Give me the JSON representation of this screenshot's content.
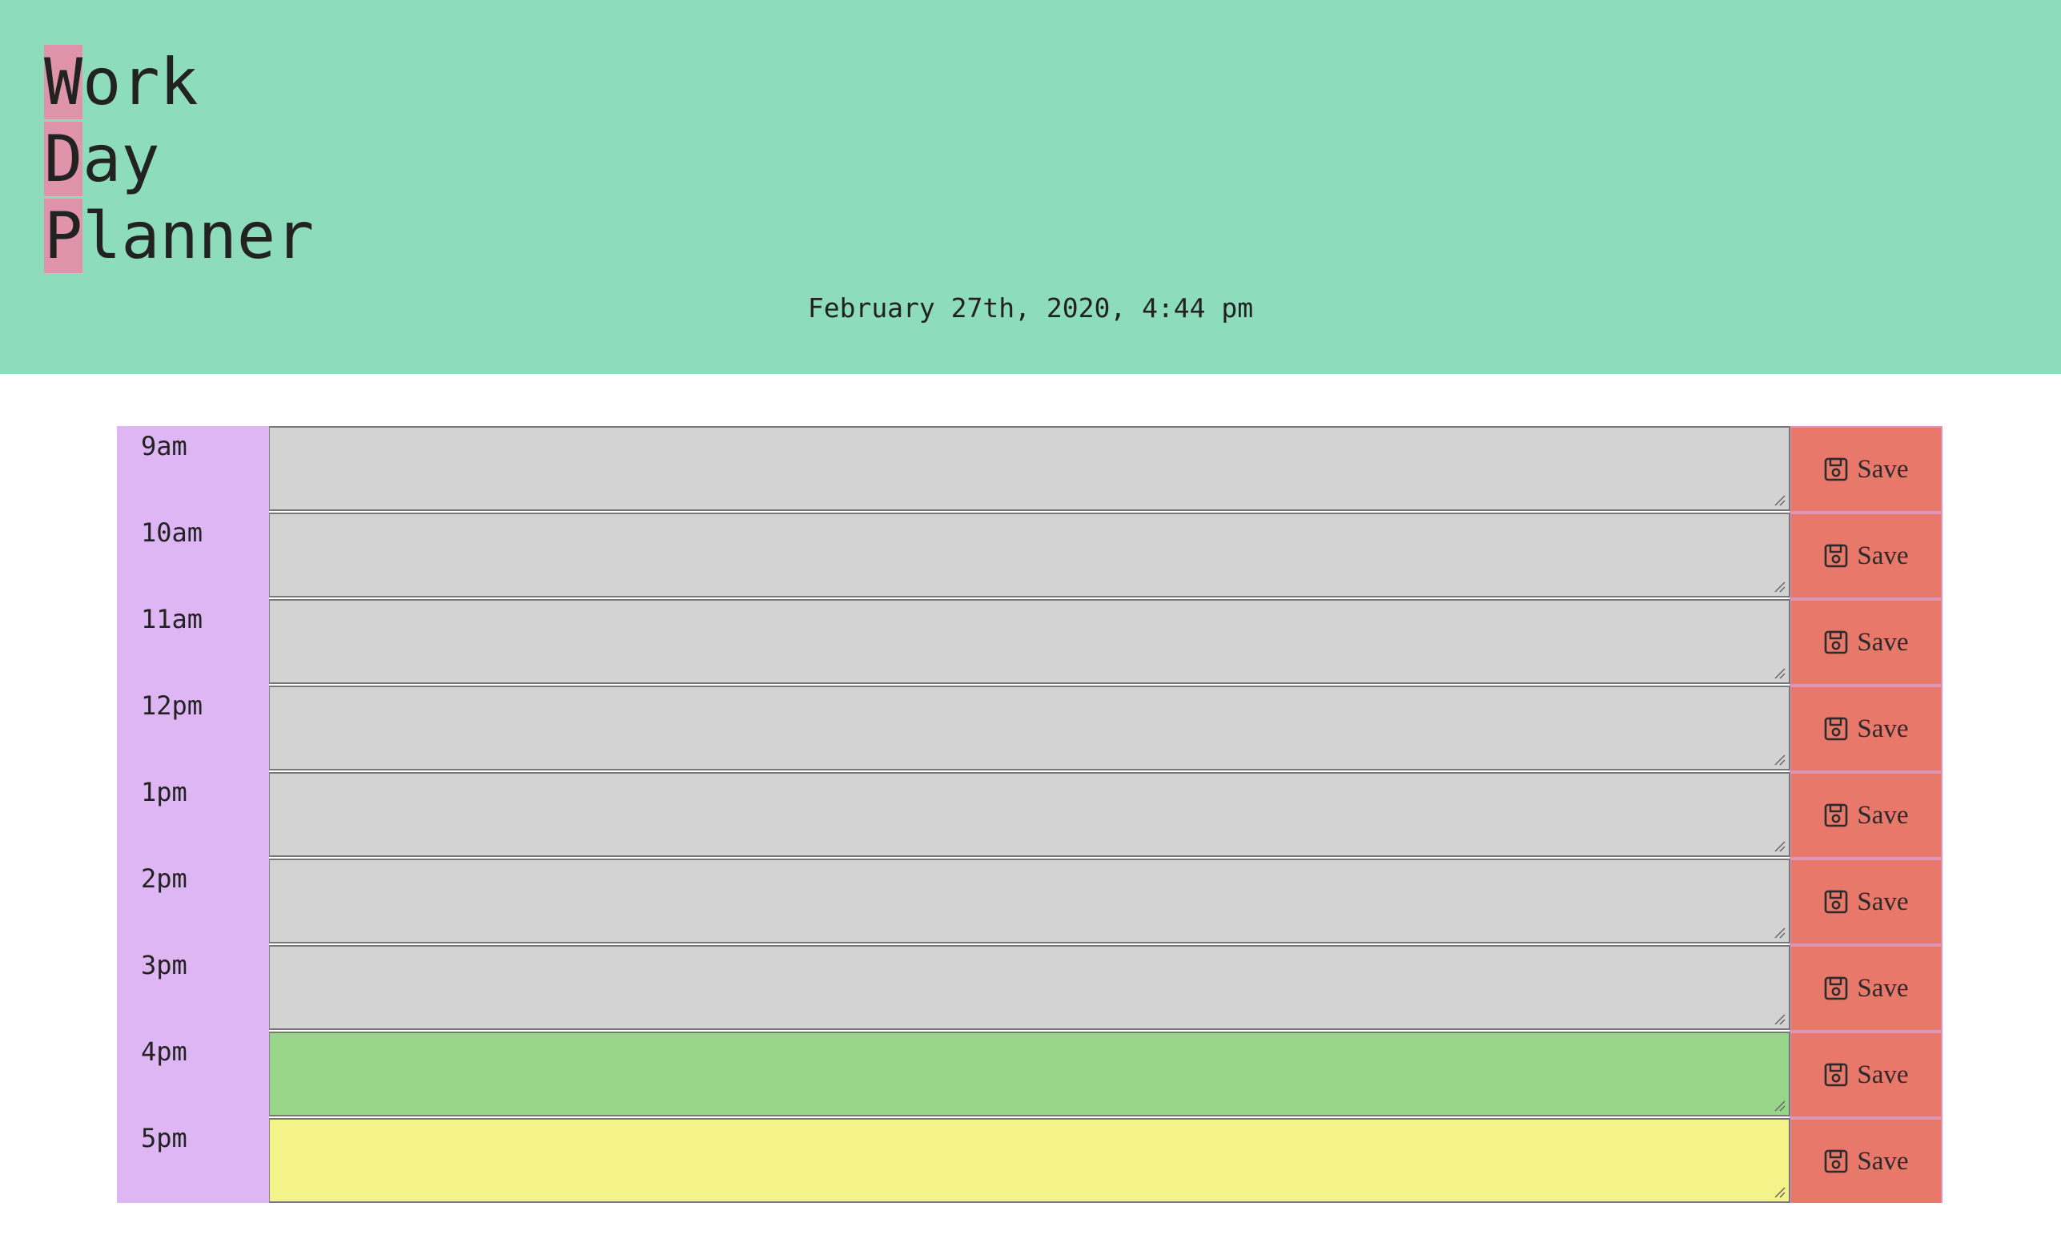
{
  "header": {
    "title_lines": [
      {
        "first": "W",
        "rest": "ork"
      },
      {
        "first": "D",
        "rest": "ay"
      },
      {
        "first": "P",
        "rest": "lanner"
      }
    ],
    "current_date": "February 27th, 2020, 4:44 pm"
  },
  "colors": {
    "header_bg": "#8ddcbc",
    "title_highlight": "#df94ac",
    "hour_column": "#dfb6f4",
    "save_button": "#e8786a",
    "past": "#d3d3d3",
    "present": "#97d68b",
    "future": "#f4f38a"
  },
  "rows": [
    {
      "hour": "9am",
      "status": "past",
      "text": "",
      "save_label": "Save",
      "save_icon": "floppy-disk-icon"
    },
    {
      "hour": "10am",
      "status": "past",
      "text": "",
      "save_label": "Save",
      "save_icon": "floppy-disk-icon"
    },
    {
      "hour": "11am",
      "status": "past",
      "text": "",
      "save_label": "Save",
      "save_icon": "floppy-disk-icon"
    },
    {
      "hour": "12pm",
      "status": "past",
      "text": "",
      "save_label": "Save",
      "save_icon": "floppy-disk-icon"
    },
    {
      "hour": "1pm",
      "status": "past",
      "text": "",
      "save_label": "Save",
      "save_icon": "floppy-disk-icon"
    },
    {
      "hour": "2pm",
      "status": "past",
      "text": "",
      "save_label": "Save",
      "save_icon": "floppy-disk-icon"
    },
    {
      "hour": "3pm",
      "status": "past",
      "text": "",
      "save_label": "Save",
      "save_icon": "floppy-disk-icon"
    },
    {
      "hour": "4pm",
      "status": "present",
      "text": "",
      "save_label": "Save",
      "save_icon": "floppy-disk-icon"
    },
    {
      "hour": "5pm",
      "status": "future",
      "text": "",
      "save_label": "Save",
      "save_icon": "floppy-disk-icon"
    }
  ]
}
